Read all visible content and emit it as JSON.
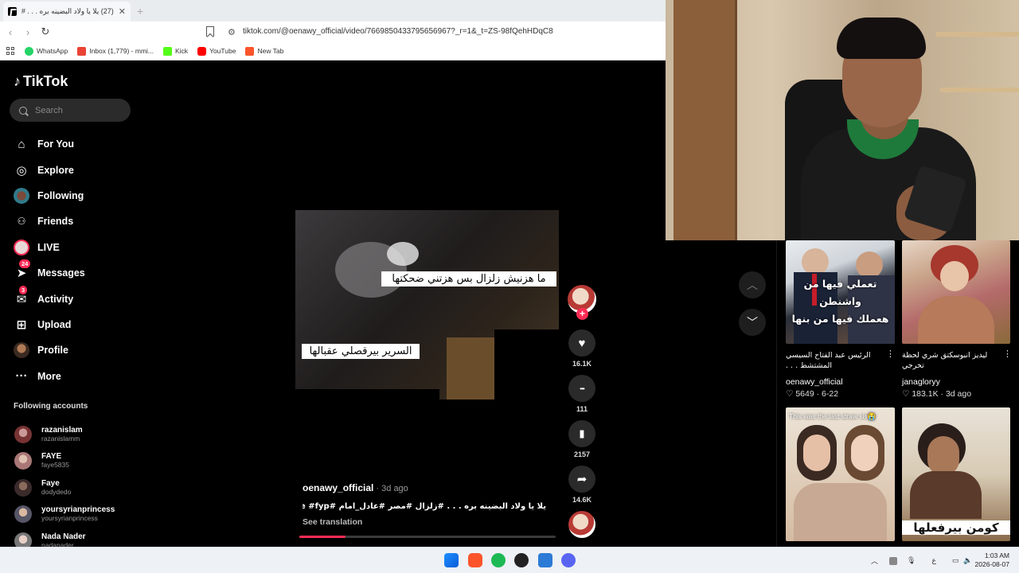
{
  "browser": {
    "tab_title": "(27) يلا يا ولاد البضينه بره . . . #زلزا",
    "tab_close": "✕",
    "new_tab": "+",
    "back": "‹",
    "forward": "›",
    "reload": "↻",
    "url": "tiktok.com/@oenawy_official/video/7669850433795656967?_r=1&_t=ZS-98fQehHDqC8",
    "bookmarks": [
      {
        "label": "WhatsApp",
        "color": "#25d366"
      },
      {
        "label": "Inbox (1,779) - mmi...",
        "color": "#ea4335"
      },
      {
        "label": "Kick",
        "color": "#53fc18"
      },
      {
        "label": "YouTube",
        "color": "#ff0000"
      },
      {
        "label": "New Tab",
        "color": "#fb542b"
      }
    ]
  },
  "tiktok": {
    "logo": "TikTok",
    "search_placeholder": "Search",
    "nav": [
      {
        "label": "For You",
        "icon": "⌂"
      },
      {
        "label": "Explore",
        "icon": "◎"
      },
      {
        "label": "Following",
        "icon": ""
      },
      {
        "label": "Friends",
        "icon": "👥"
      },
      {
        "label": "LIVE",
        "icon": ""
      },
      {
        "label": "Messages",
        "icon": "➤",
        "badge": "24"
      },
      {
        "label": "Activity",
        "icon": "✉",
        "badge": "3"
      },
      {
        "label": "Upload",
        "icon": "⊞"
      },
      {
        "label": "Profile",
        "icon": ""
      },
      {
        "label": "More",
        "icon": "···"
      }
    ],
    "following_header": "Following accounts",
    "accounts": [
      {
        "name": "razanislam",
        "handle": "razanislamm"
      },
      {
        "name": "FAYE",
        "handle": "faye5835"
      },
      {
        "name": "Faye",
        "handle": "dodydedo"
      },
      {
        "name": "yoursyrianprincess",
        "handle": "yoursyrianprincess"
      },
      {
        "name": "Nada Nader",
        "handle": "nadanader"
      }
    ],
    "video": {
      "caption_top": "ما هزنيش زلزال بس هزتني ضحكتها",
      "caption_bottom": "السرير بيرقصلي عقبالها",
      "author": "oenawy_official",
      "time_ago": " · 3d ago",
      "description": "يلا يا ولاد البضينه بره . . . #زلزال #مصر #عادل_امام #foyoupage #fyp",
      "see_translation": "See translation",
      "progress": 0.18
    },
    "actions": {
      "likes": "16.1K",
      "comments": "111",
      "saves": "2157",
      "shares": "14.6K",
      "follow_plus": "+",
      "heart": "♥",
      "comment_icon": "•••",
      "bookmark_icon": "▮",
      "share_icon": "➦"
    },
    "arrows": {
      "up": "︿",
      "down": "﹀"
    },
    "recommended": [
      {
        "overlay": "تعملي فيها من واشنطن\nهعملك فيها من بنها",
        "title": "الرئيس عبد الفتاح السيسي المشتشط . . .",
        "user": "oenawy_official",
        "meta": "♡ 5649 · 6-22"
      },
      {
        "overlay": "",
        "title": "ليديز انبوسكتق شري لحظة تخرجي",
        "user": "janagloryy",
        "meta": "♡ 183.1K · 3d ago"
      },
      {
        "overlay": "This was the last straw sis😭",
        "title": "",
        "user": "",
        "meta": ""
      },
      {
        "overlay": "كومن بيرفعلها",
        "title": "",
        "user": "",
        "meta": ""
      }
    ],
    "kebab": "⋮"
  },
  "taskbar": {
    "time": "1:03 AM",
    "date": "2026-08-07",
    "lang": "ع",
    "chevron": "︿"
  }
}
